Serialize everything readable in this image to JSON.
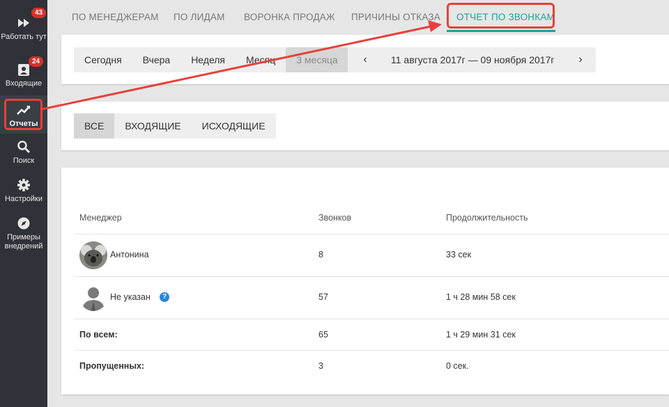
{
  "sidebar": {
    "items": [
      {
        "label": "Работать тут",
        "icon": "fast-forward-icon",
        "badge": "43"
      },
      {
        "label": "Входящие",
        "icon": "inbox-icon",
        "badge": "24"
      },
      {
        "label": "Отчеты",
        "icon": "trending-up-icon",
        "badge": ""
      },
      {
        "label": "Поиск",
        "icon": "search-icon",
        "badge": ""
      },
      {
        "label": "Настройки",
        "icon": "gear-icon",
        "badge": ""
      },
      {
        "label": "Примеры внедрений",
        "icon": "compass-icon",
        "badge": ""
      }
    ]
  },
  "tabs": [
    {
      "label": "ПО МЕНЕДЖЕРАМ"
    },
    {
      "label": "ПО ЛИДАМ"
    },
    {
      "label": "ВОРОНКА ПРОДАЖ"
    },
    {
      "label": "ПРИЧИНЫ ОТКАЗА"
    },
    {
      "label": "ОТЧЕТ ПО ЗВОНКАМ"
    }
  ],
  "period": {
    "options": [
      "Сегодня",
      "Вчера",
      "Неделя",
      "Месяц",
      "3 месяца"
    ],
    "selected": "3 месяца",
    "range": "11 августа 2017г — 09 ноября 2017г"
  },
  "direction": {
    "options": [
      "ВСЕ",
      "ВХОДЯЩИЕ",
      "ИСХОДЯЩИЕ"
    ],
    "selected": "ВСЕ"
  },
  "table": {
    "headers": [
      "Менеджер",
      "Звонков",
      "Продолжительность"
    ],
    "rows": [
      {
        "name": "Антонина",
        "calls": "8",
        "duration": "33 сек"
      },
      {
        "name": "Не указан",
        "calls": "57",
        "duration": "1 ч 28 мин 58 сек"
      }
    ],
    "total": {
      "label": "По всем:",
      "calls": "65",
      "duration": "1 ч 29 мин 31 сек"
    },
    "missed": {
      "label": "Пропущенных:",
      "calls": "3",
      "duration": "0 сек."
    }
  },
  "colors": {
    "accent": "#1aa39a",
    "highlight": "#e8403a",
    "badge": "#d9302c",
    "sidebar": "#2f3238"
  }
}
